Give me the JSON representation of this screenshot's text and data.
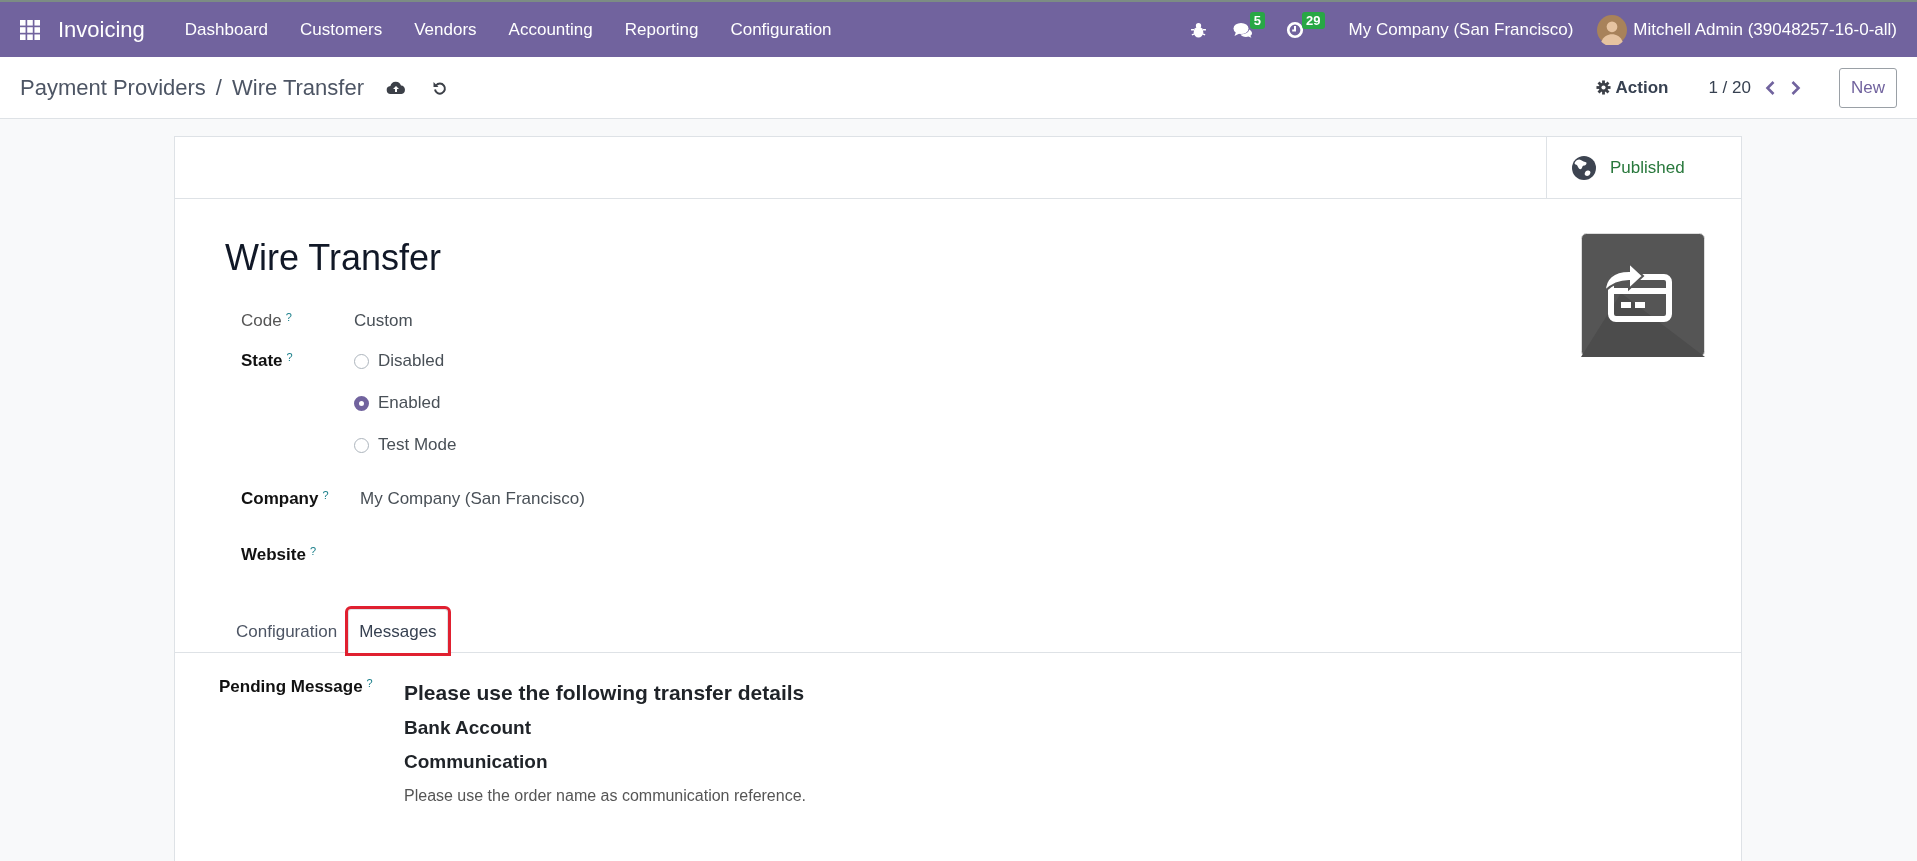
{
  "navbar": {
    "app_name": "Invoicing",
    "menu": [
      "Dashboard",
      "Customers",
      "Vendors",
      "Accounting",
      "Reporting",
      "Configuration"
    ],
    "messages_count": "5",
    "activities_count": "29",
    "company": "My Company (San Francisco)",
    "user": "Mitchell Admin (39048257-16-0-all)"
  },
  "control_panel": {
    "breadcrumb_parent": "Payment Providers",
    "breadcrumb_separator": "/",
    "breadcrumb_current": "Wire Transfer",
    "action_label": "Action",
    "pager": "1 / 20",
    "new_button": "New"
  },
  "status": {
    "label": "Published",
    "published": true
  },
  "record": {
    "title": "Wire Transfer",
    "code": {
      "label": "Code",
      "help": "?",
      "value": "Custom"
    },
    "state": {
      "label": "State",
      "help": "?",
      "options": [
        {
          "label": "Disabled",
          "selected": false
        },
        {
          "label": "Enabled",
          "selected": true
        },
        {
          "label": "Test Mode",
          "selected": false
        }
      ]
    },
    "company": {
      "label": "Company",
      "help": "?",
      "value": "My Company (San Francisco)"
    },
    "website": {
      "label": "Website",
      "help": "?"
    }
  },
  "tabs": [
    {
      "label": "Configuration",
      "selected": false,
      "highlighted": false
    },
    {
      "label": "Messages",
      "selected": true,
      "highlighted": true
    }
  ],
  "pending_message": {
    "label": "Pending Message",
    "help": "?",
    "content": [
      {
        "kind": "heading",
        "text": "Please use the following transfer details"
      },
      {
        "kind": "subheading",
        "text": "Bank Account"
      },
      {
        "kind": "subheading",
        "text": "Communication"
      },
      {
        "kind": "text",
        "text": "Please use the order name as communication reference."
      }
    ]
  }
}
